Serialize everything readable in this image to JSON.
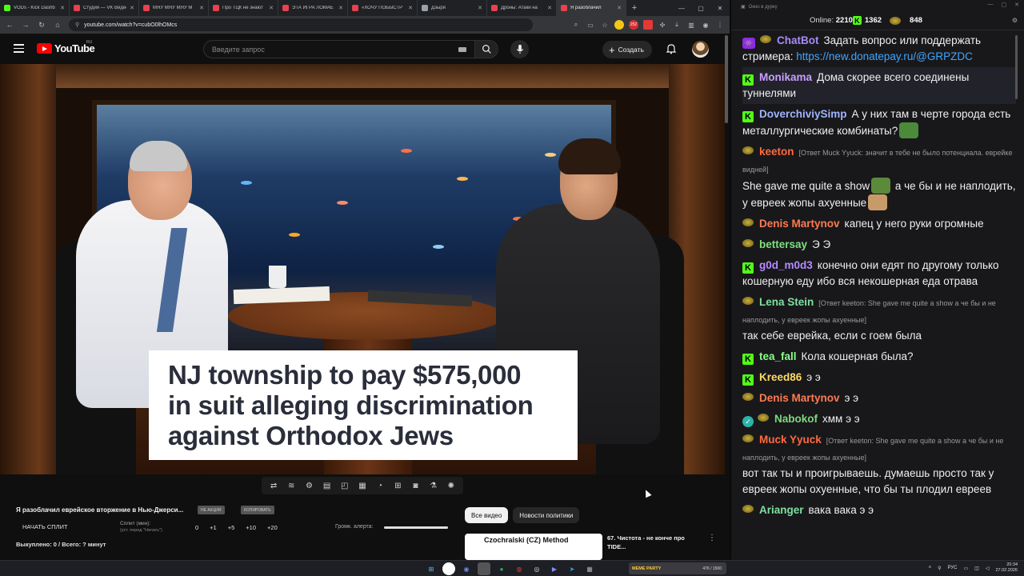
{
  "browser": {
    "tabs": [
      {
        "label": "VODs - Kick Dashb",
        "fav": "#53fc18",
        "active": false
      },
      {
        "label": "Студия — VK Видео",
        "fav": "#e8414f",
        "active": false
      },
      {
        "label": "МЯУ МЯУ МЯУ М",
        "fav": "#e8414f",
        "active": false
      },
      {
        "label": "Про ТЦК не знают",
        "fav": "#e8414f",
        "active": false
      },
      {
        "label": "ЭТА ИГРА ЛОМАЕ",
        "fav": "#e8414f",
        "active": false
      },
      {
        "label": "«ХОЧУ ПОБЫСТР",
        "fav": "#e8414f",
        "active": false
      },
      {
        "label": "Дзыря",
        "fav": "#9aa0a6",
        "active": false
      },
      {
        "label": "Дроны: Атаки на",
        "fav": "#e8414f",
        "active": false
      },
      {
        "label": "Я разоблачил",
        "fav": "#e8414f",
        "active": true
      }
    ],
    "url": "youtube.com/watch?v=cubO0lhOMcs",
    "badge_count": "252"
  },
  "youtube": {
    "logo_text": "YouTube",
    "region": "RU",
    "search_placeholder": "Введите запрос",
    "create_label": "Создать"
  },
  "video": {
    "caption_lines": [
      "NJ township to pay $575,000",
      "in suit alleging discrimination",
      "against Orthodox Jews"
    ]
  },
  "below": {
    "title": "Я разоблачил еврейское вторжение в Нью-Джерси...",
    "pill1": "НЕ АКЦИЯ",
    "pill2": "КОПИРОВАТЬ",
    "split_button": "НАЧАТЬ СПЛИТ",
    "split_label": "Сплит (мин):",
    "split_sub": "(уст. перед \"Начать\")",
    "split_values": [
      "0",
      "+1",
      "+5",
      "+10",
      "+20"
    ],
    "alert_label": "Громк. алерта:",
    "alert_volume": 1.0,
    "bought": "Выкуплено: 0 / Всего: ? минут",
    "chips": [
      "Все видео",
      "Новости политики"
    ],
    "rec_thumb_text": "Czochralski (CZ) Method",
    "rec_title": "67. Чистота - не конче про TIDE..."
  },
  "chat": {
    "window_title": "Окно в дурку",
    "online_label": "Online:",
    "online_count": "2210",
    "stat1": "1362",
    "stat2": "848",
    "messages": [
      {
        "badge": "bot",
        "nick": "ChatBot",
        "color": "#a78bfa",
        "reply": "",
        "text": "Задать вопрос или поддержать стримера: ",
        "link": "https://new.donatepay.ru/@GRPZDC",
        "hl": false
      },
      {
        "badge": "k",
        "nick": "Monikama",
        "color": "#c8a0ff",
        "reply": "",
        "text": "Дома скорее всего соединены туннелями",
        "link": "",
        "hl": true
      },
      {
        "badge": "k",
        "nick": "DoverchiviySimp",
        "color": "#9fb4ff",
        "reply": "",
        "text": "А у них там в черте города есть металлургические комбинаты?",
        "link": "",
        "emote": "#4a8a3a",
        "hl": false
      },
      {
        "badge": "m",
        "nick": "keeton",
        "color": "#ff6a3d",
        "reply": "[Ответ Muck Yyuck: значит в тебе не было потенциала. еврейке видней]",
        "text": "She gave me quite a show",
        "text2": "а че бы и не наплодить, у евреек жопы ахуенные",
        "link": "",
        "emote": "#5a8a3a",
        "emote2": "#c89a6a",
        "hl": false
      },
      {
        "badge": "m",
        "nick": "Denis Martynov",
        "color": "#ff7a50",
        "reply": "",
        "text": "капец у него руки огромные",
        "link": "",
        "hl": false
      },
      {
        "badge": "m",
        "nick": "bettersay",
        "color": "#7ee07e",
        "reply": "",
        "text": "Э Э",
        "link": "",
        "hl": false
      },
      {
        "badge": "k",
        "nick": "g0d_m0d3",
        "color": "#b48cff",
        "reply": "",
        "text": "конечно они едят по другому только кошерную еду ибо вся некошерная еда отрава",
        "link": "",
        "hl": false
      },
      {
        "badge": "m",
        "nick": "Lena Stein",
        "color": "#7ee0a0",
        "reply": "[Ответ keeton: She gave me quite a show а че бы и не наплодить, у евреек жопы ахуенные]",
        "text": "так себе еврейка, если с гоем была",
        "link": "",
        "hl": false
      },
      {
        "badge": "k",
        "nick": "tea_fall",
        "color": "#8aff8a",
        "reply": "",
        "text": "Кола кошерная была?",
        "link": "",
        "hl": false
      },
      {
        "badge": "k",
        "nick": "Kreed86",
        "color": "#ffd966",
        "reply": "",
        "text": "э э",
        "link": "",
        "hl": false
      },
      {
        "badge": "m",
        "nick": "Denis Martynov",
        "color": "#ff7a50",
        "reply": "",
        "text": "э э",
        "link": "",
        "hl": false
      },
      {
        "badge": "vm",
        "nick": "Nabokof",
        "color": "#7ed87e",
        "reply": "",
        "text": "хмм э э",
        "link": "",
        "hl": false
      },
      {
        "badge": "m",
        "nick": "Muck Yyuck",
        "color": "#ff6a3d",
        "reply": "[Ответ keeton: She gave me quite a show а че бы и не наплодить, у евреек жопы ахуенные]",
        "text": "вот так ты и проигрываешь. думаешь просто так у евреек жопы охуенные, что бы ты плодил евреев",
        "link": "",
        "hl": false
      },
      {
        "badge": "m",
        "nick": "Arianger",
        "color": "#7ee0a0",
        "reply": "",
        "text": "вака вака э э",
        "link": "",
        "hl": false
      }
    ]
  },
  "taskbar": {
    "widget_label": "MEME PARTY",
    "widget_count": "476 / 1500",
    "lang": "РУС",
    "time": "20:34",
    "date": "27.02.2026"
  }
}
